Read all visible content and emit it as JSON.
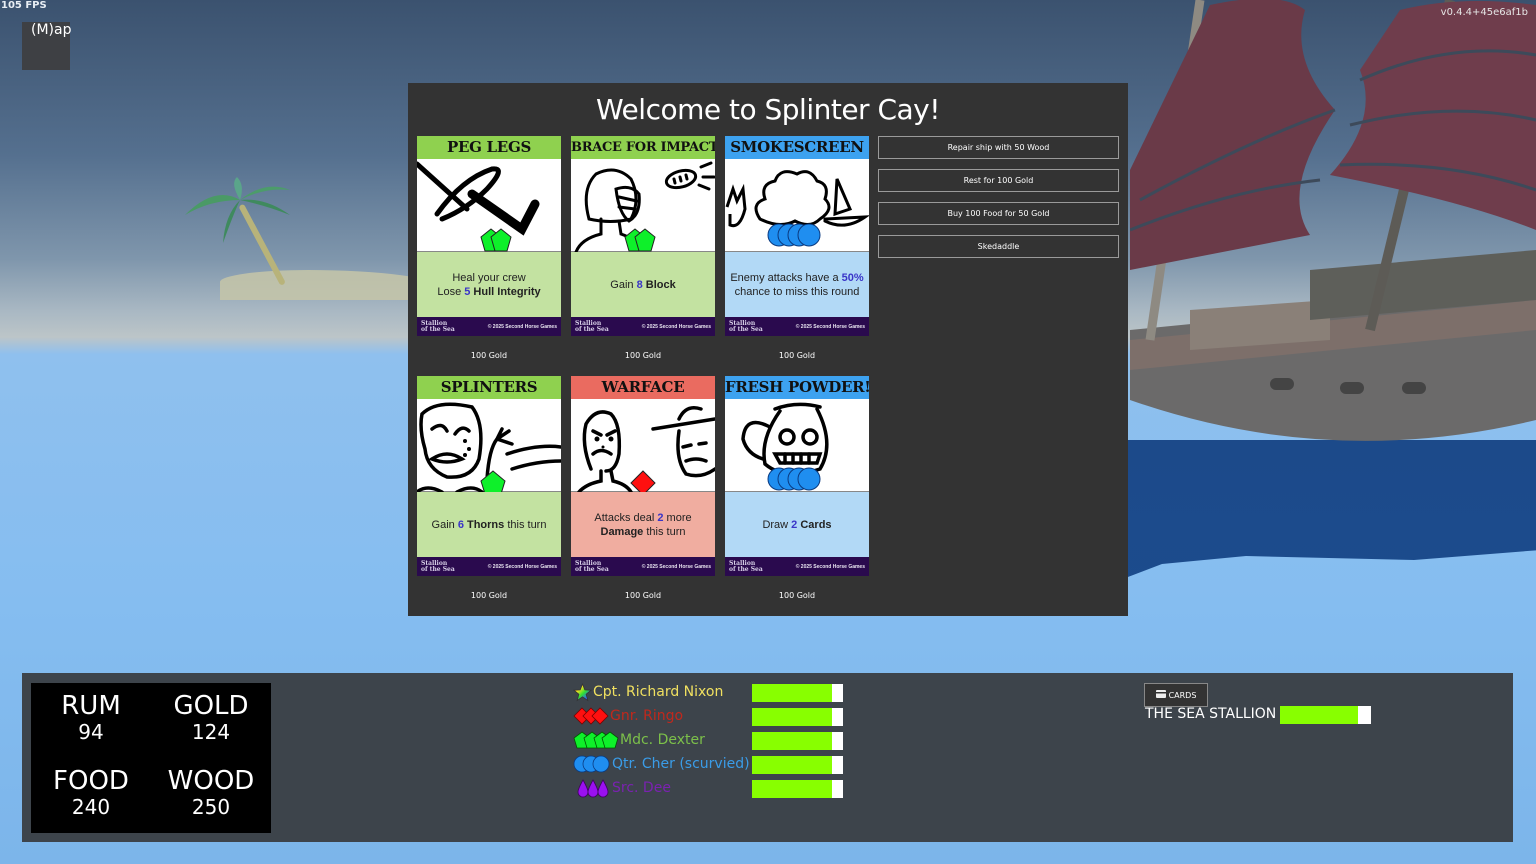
{
  "overlay": {
    "fps": "105 FPS",
    "version": "v0.4.4+45e6af1b",
    "map_button": "(M)ap"
  },
  "dialog": {
    "title": "Welcome to Splinter Cay!",
    "cards": [
      {
        "title": "PEG LEGS",
        "theme": "green",
        "icon": "pentagon-icon",
        "icon_count": 2,
        "text_parts": [
          [
            "Heal your crew",
            ""
          ],
          [
            "Lose ",
            "",
            "5",
            "num",
            " Hull Integrity",
            "bold"
          ]
        ],
        "price": "100 Gold"
      },
      {
        "title": "BRACE FOR IMPACT",
        "theme": "green",
        "icon": "pentagon-icon",
        "icon_count": 2,
        "price": "100 Gold"
      },
      {
        "title": "SMOKESCREEN",
        "theme": "blue",
        "icon": "cloud-icon",
        "icon_count": 4,
        "price": "100 Gold"
      },
      {
        "title": "SPLINTERS",
        "theme": "green",
        "icon": "pentagon-icon",
        "icon_count": 1,
        "price": "100 Gold"
      },
      {
        "title": "WARFACE",
        "theme": "red",
        "icon": "diamond-icon",
        "icon_count": 1,
        "price": "100 Gold"
      },
      {
        "title": "FRESH POWDER!",
        "theme": "blue",
        "icon": "cloud-icon",
        "icon_count": 4,
        "price": "100 Gold"
      }
    ],
    "card_text": {
      "peg_legs": {
        "line1": "Heal your crew",
        "l2a": "Lose ",
        "l2num": "5",
        "l2b": " Hull Integrity"
      },
      "brace": {
        "a": "Gain ",
        "num": "8",
        "b": " Block"
      },
      "smokescreen": {
        "a": "Enemy attacks have a ",
        "num": "50%",
        "b": "chance to miss this round"
      },
      "splinters": {
        "a": "Gain ",
        "num": "6",
        "b": " Thorns",
        "c": " this turn"
      },
      "warface": {
        "a": "Attacks deal ",
        "num": "2",
        "b": " more",
        "c": "Damage",
        "d": " this turn"
      },
      "fresh_powder": {
        "a": "Draw ",
        "num": "2",
        "b": " Cards"
      }
    },
    "card_footer": {
      "logo_line1": "Stallion",
      "logo_line2": "of the Sea",
      "copyright": "© 2025 Second Horse Games"
    },
    "actions": [
      "Repair ship with 50 Wood",
      "Rest for 100 Gold",
      "Buy 100 Food for 50 Gold",
      "Skedaddle"
    ]
  },
  "hud": {
    "resources": [
      {
        "label": "RUM",
        "value": "94"
      },
      {
        "label": "GOLD",
        "value": "124"
      },
      {
        "label": "FOOD",
        "value": "240"
      },
      {
        "label": "WOOD",
        "value": "250"
      }
    ],
    "crew": [
      {
        "name": "Cpt. Richard Nixon",
        "color": "#f0e060",
        "icon": "rainbow-star-icon",
        "icon_count": 1,
        "health_fraction": 0.88
      },
      {
        "name": "Gnr. Ringo",
        "color": "#c0281c",
        "icon": "red-diamond-icon",
        "icon_count": 3,
        "health_fraction": 0.88
      },
      {
        "name": "Mdc. Dexter",
        "color": "#7cc04a",
        "icon": "green-pentagon-icon",
        "icon_count": 4,
        "health_fraction": 0.88
      },
      {
        "name": "Qtr. Cher (scurvied)",
        "color": "#3a9ce8",
        "icon": "blue-cloud-icon",
        "icon_count": 3,
        "health_fraction": 0.88
      },
      {
        "name": "Src. Dee",
        "color": "#7a22b0",
        "icon": "purple-drop-icon",
        "icon_count": 3,
        "health_fraction": 0.88
      }
    ],
    "cards_button": "CARDS",
    "ship": {
      "name": "THE SEA STALLION",
      "health_fraction": 0.86
    }
  }
}
